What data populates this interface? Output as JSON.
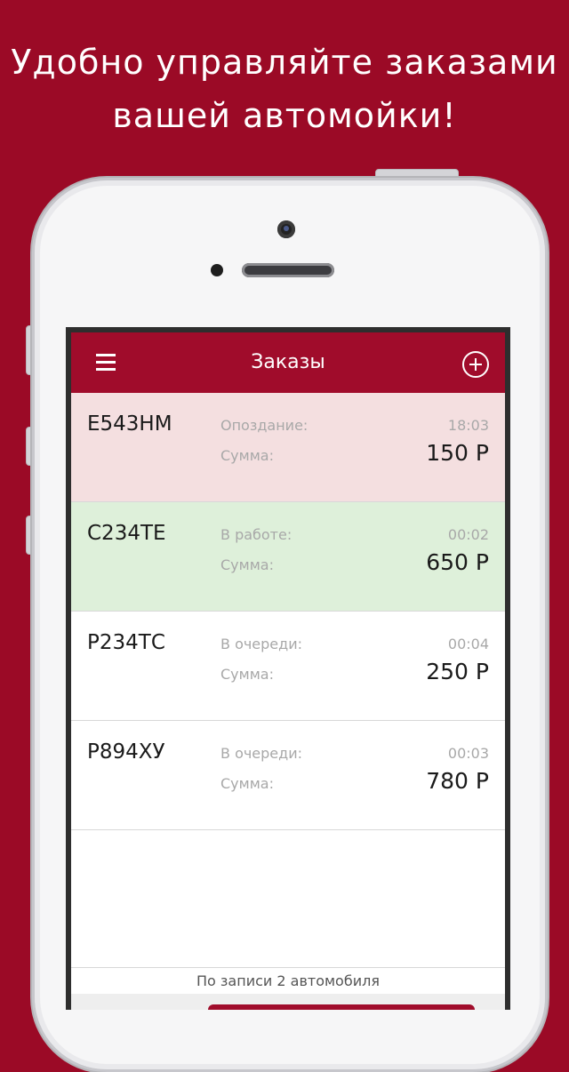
{
  "promo": {
    "line1": "Удобно управляйте заказами",
    "line2": "вашей автомойки!"
  },
  "header": {
    "title": "Заказы",
    "menu_icon": "hamburger-menu-icon",
    "add_icon": "plus-circle-icon"
  },
  "orders": [
    {
      "plate": "Е543НМ",
      "status_label": "Опоздание:",
      "time": "18:03",
      "sum_label": "Сумма:",
      "sum": "150 Р",
      "bg": "#f4dfe0"
    },
    {
      "plate": "С234ТЕ",
      "status_label": "В работе:",
      "time": "00:02",
      "sum_label": "Сумма:",
      "sum": "650 Р",
      "bg": "#def0da"
    },
    {
      "plate": "Р234ТС",
      "status_label": "В очереди:",
      "time": "00:04",
      "sum_label": "Сумма:",
      "sum": "250 Р",
      "bg": "#ffffff"
    },
    {
      "plate": "Р894ХУ",
      "status_label": "В очереди:",
      "time": "00:03",
      "sum_label": "Сумма:",
      "sum": "780 Р",
      "bg": "#ffffff"
    }
  ],
  "footer": {
    "note": "По записи 2 автомобиля"
  },
  "colors": {
    "background": "#9b0a26",
    "header": "#a00c2b",
    "late_row": "#f4dfe0",
    "in_work_row": "#def0da"
  }
}
